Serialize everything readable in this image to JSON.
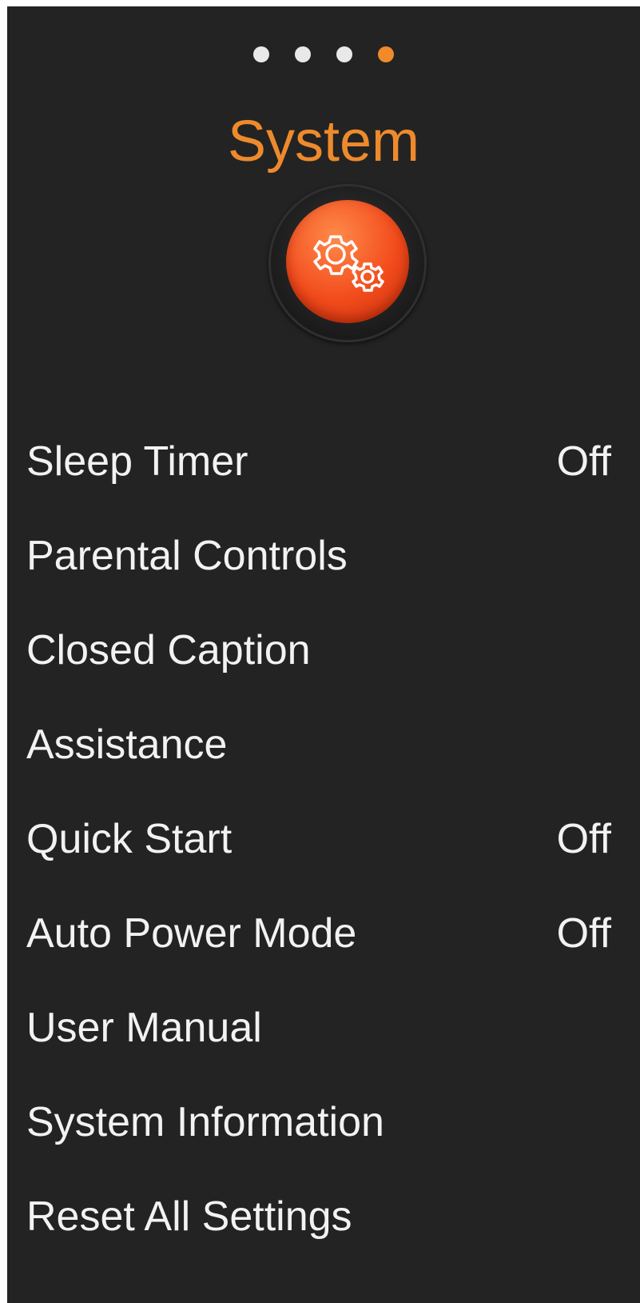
{
  "pager": {
    "count": 4,
    "active_index": 3
  },
  "header": {
    "title": "System",
    "icon": "gears-icon"
  },
  "colors": {
    "accent": "#ee8a2c",
    "background": "#232323",
    "text": "#f2f2f2"
  },
  "menu": {
    "items": [
      {
        "label": "Sleep Timer",
        "value": "Off"
      },
      {
        "label": "Parental Controls",
        "value": ""
      },
      {
        "label": "Closed Caption",
        "value": ""
      },
      {
        "label": "Assistance",
        "value": ""
      },
      {
        "label": "Quick Start",
        "value": "Off"
      },
      {
        "label": "Auto Power Mode",
        "value": "Off"
      },
      {
        "label": "User Manual",
        "value": ""
      },
      {
        "label": "System Information",
        "value": ""
      },
      {
        "label": "Reset All Settings",
        "value": ""
      }
    ]
  }
}
